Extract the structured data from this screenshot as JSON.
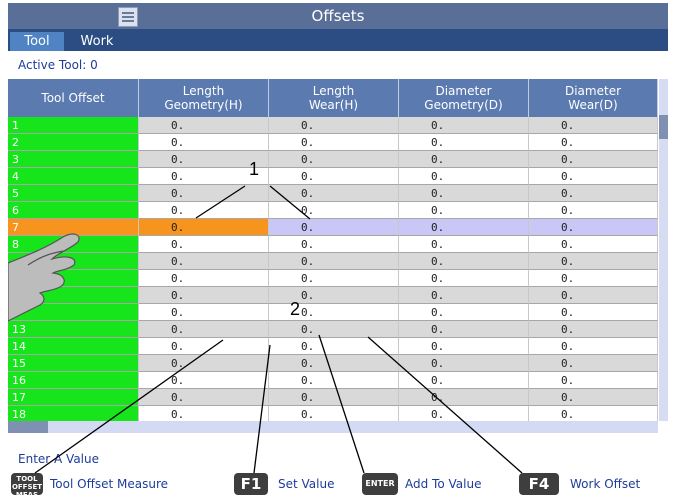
{
  "window": {
    "title": "Offsets"
  },
  "tabs": [
    {
      "label": "Tool",
      "active": true
    },
    {
      "label": "Work",
      "active": false
    }
  ],
  "active_tool": "Active Tool: 0",
  "table": {
    "headers": [
      {
        "line1": "Tool Offset",
        "line2": ""
      },
      {
        "line1": "Length",
        "line2": "Geometry(H)"
      },
      {
        "line1": "Length",
        "line2": "Wear(H)"
      },
      {
        "line1": "Diameter",
        "line2": "Geometry(D)"
      },
      {
        "line1": "Diameter",
        "line2": "Wear(D)"
      }
    ],
    "rows": [
      {
        "id": "1",
        "values": [
          "0.",
          "0.",
          "0.",
          "0."
        ]
      },
      {
        "id": "2",
        "values": [
          "0.",
          "0.",
          "0.",
          "0."
        ]
      },
      {
        "id": "3",
        "values": [
          "0.",
          "0.",
          "0.",
          "0."
        ]
      },
      {
        "id": "4",
        "values": [
          "0.",
          "0.",
          "0.",
          "0."
        ]
      },
      {
        "id": "5",
        "values": [
          "0.",
          "0.",
          "0.",
          "0."
        ]
      },
      {
        "id": "6",
        "values": [
          "0.",
          "0.",
          "0.",
          "0."
        ]
      },
      {
        "id": "7",
        "values": [
          "0.",
          "0.",
          "0.",
          "0."
        ]
      },
      {
        "id": "8",
        "values": [
          "0.",
          "0.",
          "0.",
          "0."
        ]
      },
      {
        "id": "",
        "values": [
          "0.",
          "0.",
          "0.",
          "0."
        ]
      },
      {
        "id": "",
        "values": [
          "0.",
          "0.",
          "0.",
          "0."
        ]
      },
      {
        "id": "",
        "values": [
          "0.",
          "0.",
          "0.",
          "0."
        ]
      },
      {
        "id": "",
        "values": [
          "0.",
          "0.",
          "0.",
          "0."
        ]
      },
      {
        "id": "13",
        "values": [
          "0.",
          "0.",
          "0.",
          "0."
        ]
      },
      {
        "id": "14",
        "values": [
          "0.",
          "0.",
          "0.",
          "0."
        ]
      },
      {
        "id": "15",
        "values": [
          "0.",
          "0.",
          "0.",
          "0."
        ]
      },
      {
        "id": "16",
        "values": [
          "0.",
          "0.",
          "0.",
          "0."
        ]
      },
      {
        "id": "17",
        "values": [
          "0.",
          "0.",
          "0.",
          "0."
        ]
      },
      {
        "id": "18",
        "values": [
          "0.",
          "0.",
          "0.",
          "0."
        ]
      }
    ],
    "selected_row": "7"
  },
  "prompt": "Enter A Value",
  "keys": [
    {
      "cap": "TOOL OFFSET MEAS",
      "label": "Tool Offset Measure"
    },
    {
      "cap": "F1",
      "label": "Set Value"
    },
    {
      "cap": "ENTER",
      "label": "Add To Value"
    },
    {
      "cap": "F4",
      "label": "Work Offset"
    }
  ],
  "callouts": {
    "one": "1",
    "two": "2"
  },
  "colors": {
    "title_bg": "#5a6f98",
    "tab_bg": "#2b4d83",
    "index_green": "#17e51c",
    "selected_orange": "#f7941d",
    "selected_lavender": "#c9c7f6",
    "header_bg": "#5a7ab0"
  }
}
